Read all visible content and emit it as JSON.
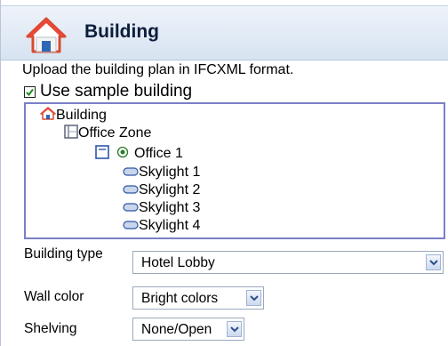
{
  "panel": {
    "title": "Building",
    "instruction": "Upload the building plan in IFCXML format.",
    "sample_checkbox": {
      "label": "Use sample building",
      "checked": true
    }
  },
  "tree": {
    "root": "Building",
    "zone": "Office Zone",
    "office": "Office 1",
    "skylights": [
      "Skylight 1",
      "Skylight 2",
      "Skylight 3",
      "Skylight 4"
    ]
  },
  "form": {
    "building_type": {
      "label": "Building type",
      "value": "Hotel Lobby"
    },
    "wall_color": {
      "label": "Wall color",
      "value": "Bright colors"
    },
    "shelving": {
      "label": "Shelving",
      "value": "None/Open"
    }
  },
  "colors": {
    "header_title": "#0b1d3b",
    "tree_border": "#7a80c6",
    "home_icon": "#e8483a"
  },
  "icons": {
    "header": "home-icon",
    "root": "home-icon",
    "zone": "zone-icon",
    "office": "room-icon",
    "selected": "radio-selected-icon",
    "skylight": "skylight-icon",
    "dropdown": "chevron-down-icon"
  }
}
